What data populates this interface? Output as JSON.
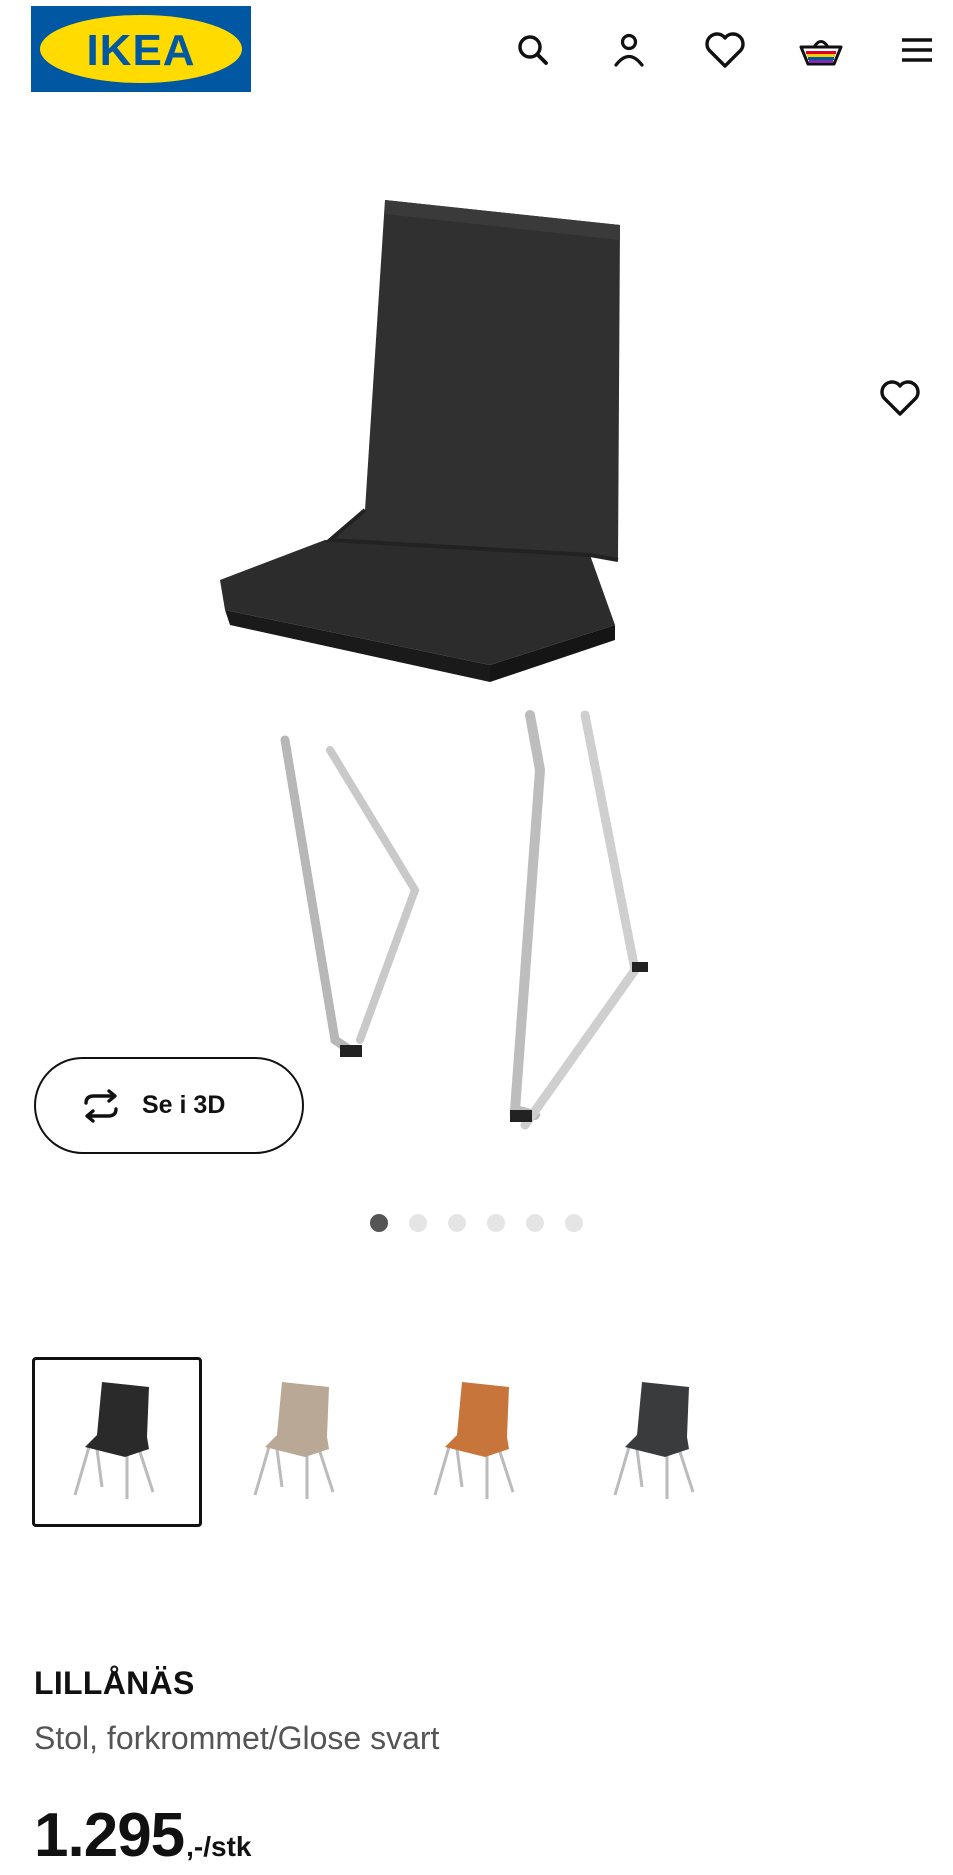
{
  "header": {
    "logo_text": "IKEA",
    "brand_colors": {
      "blue": "#0058a3",
      "yellow": "#ffdb00"
    },
    "icons": [
      "search-icon",
      "account-icon",
      "heart-icon",
      "basket-icon",
      "menu-icon"
    ]
  },
  "hero": {
    "favorite_icon": "heart-icon",
    "view_3d_label": "Se i 3D",
    "view_3d_icon": "rotate-icon",
    "carousel": {
      "total": 6,
      "active_index": 0
    }
  },
  "variants": [
    {
      "color": "#2a2a2a",
      "selected": true
    },
    {
      "color": "#b9a896",
      "selected": false
    },
    {
      "color": "#c7753a",
      "selected": false
    },
    {
      "color": "#3a3b3d",
      "selected": false
    }
  ],
  "product": {
    "name": "LILLÅNÄS",
    "description": "Stol, forkrommet/Glose svart",
    "price_main": "1.295",
    "price_suffix": ",-/stk"
  }
}
